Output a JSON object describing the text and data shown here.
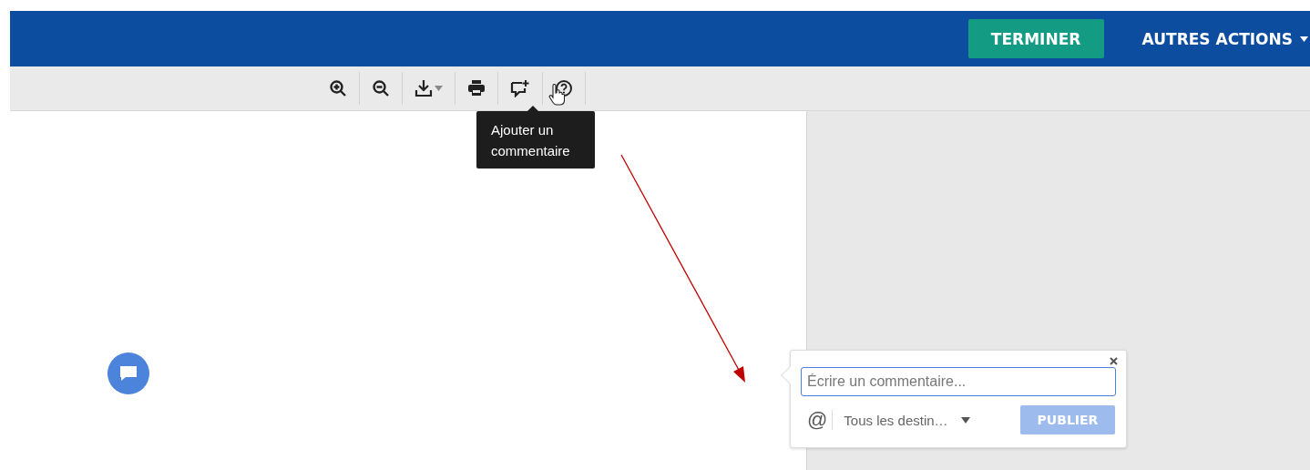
{
  "header": {
    "buttons": [
      {
        "label": "TERMINER",
        "kind": "primary"
      },
      {
        "label": "AUTRES ACTIONS",
        "kind": "menu"
      }
    ]
  },
  "toolbar": {
    "tools": [
      {
        "kind": "zoom-in"
      },
      {
        "kind": "zoom-out"
      },
      {
        "kind": "download"
      },
      {
        "kind": "print"
      },
      {
        "kind": "add-comment"
      },
      {
        "kind": "help"
      }
    ]
  },
  "tooltip": {
    "text": "Ajouter un commentaire"
  },
  "comment_popup": {
    "mention": "@",
    "placeholder": "Écrire un commentaire...",
    "recipients": "Tous les destin…",
    "publish": {
      "label": "PUBLIER",
      "disabled": true
    }
  }
}
